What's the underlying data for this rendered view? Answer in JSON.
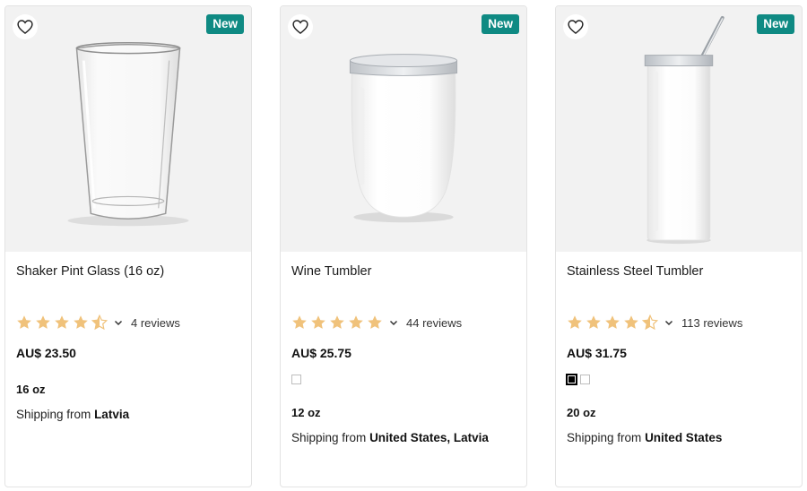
{
  "colors": {
    "badge": "#0f8a83",
    "star": "#f0c27b",
    "star_empty": "#e0e0e0"
  },
  "products": [
    {
      "badge": "New",
      "title": "Shaker Pint Glass (16 oz)",
      "rating": 4.5,
      "reviews": "4 reviews",
      "price": "AU$ 23.50",
      "swatches": [],
      "size": "16 oz",
      "shipping_prefix": "Shipping from",
      "shipping_from": "Latvia",
      "image_icon": "pint-glass-image"
    },
    {
      "badge": "New",
      "title": "Wine Tumbler",
      "rating": 5,
      "reviews": "44 reviews",
      "price": "AU$ 25.75",
      "swatches": [
        "white"
      ],
      "size": "12 oz",
      "shipping_prefix": "Shipping from",
      "shipping_from": "United States, Latvia",
      "image_icon": "wine-tumbler-image"
    },
    {
      "badge": "New",
      "title": "Stainless Steel Tumbler",
      "rating": 4.5,
      "reviews": "113 reviews",
      "price": "AU$ 31.75",
      "swatches": [
        "black",
        "white"
      ],
      "size": "20 oz",
      "shipping_prefix": "Shipping from",
      "shipping_from": "United States",
      "image_icon": "steel-tumbler-image"
    }
  ]
}
